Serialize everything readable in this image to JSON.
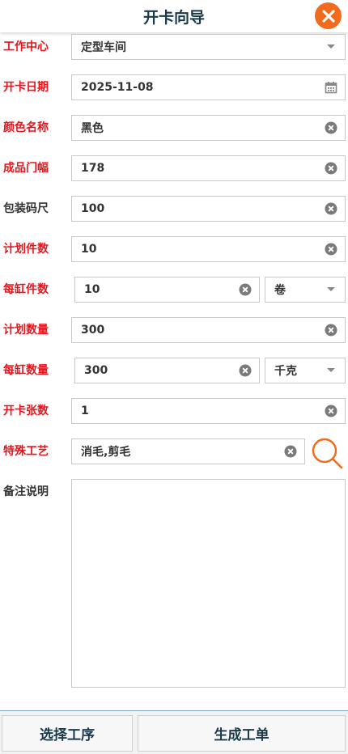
{
  "header": {
    "title": "开卡向导"
  },
  "fields": {
    "work_center": {
      "label": "工作中心",
      "value": "定型车间"
    },
    "open_date": {
      "label": "开卡日期",
      "value": "2025-11-08"
    },
    "color_name": {
      "label": "颜色名称",
      "value": "黑色"
    },
    "width": {
      "label": "成品门幅",
      "value": "178"
    },
    "pack_size": {
      "label": "包装码尺",
      "value": "100"
    },
    "plan_pieces": {
      "label": "计划件数",
      "value": "10"
    },
    "per_vat_pieces": {
      "label": "每缸件数",
      "value": "10",
      "unit": "卷"
    },
    "plan_qty": {
      "label": "计划数量",
      "value": "300"
    },
    "per_vat_qty": {
      "label": "每缸数量",
      "value": "300",
      "unit": "千克"
    },
    "card_count": {
      "label": "开卡张数",
      "value": "1"
    },
    "special_process": {
      "label": "特殊工艺",
      "value": "消毛,剪毛"
    },
    "remarks": {
      "label": "备注说明",
      "value": ""
    }
  },
  "footer": {
    "select_process": "选择工序",
    "generate_order": "生成工单"
  },
  "colors": {
    "required_label": "#e8141c",
    "accent": "#f26a1b",
    "title": "#1a3a4a"
  },
  "icons": [
    "close-icon",
    "chevron-down-icon",
    "calendar-icon",
    "clear-icon",
    "search-icon"
  ]
}
